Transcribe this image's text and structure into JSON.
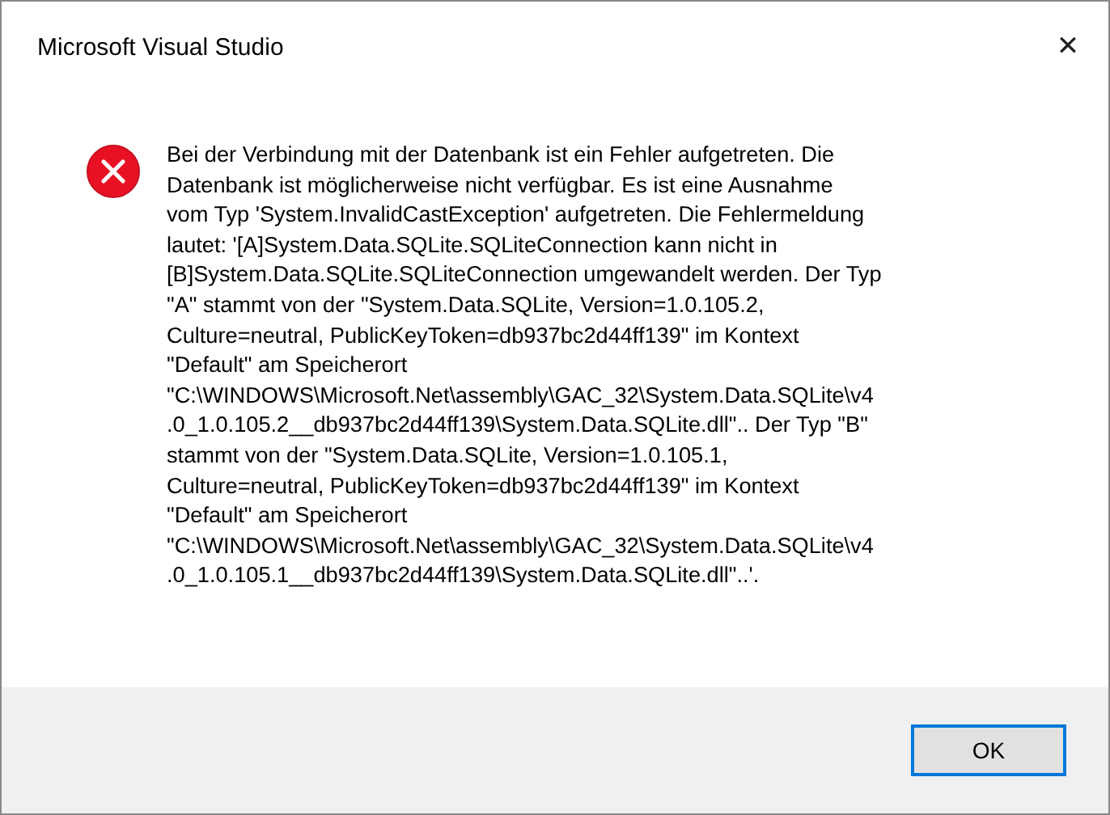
{
  "window": {
    "title": "Microsoft Visual Studio",
    "close": "✕"
  },
  "message": "Bei der Verbindung mit der Datenbank ist ein Fehler aufgetreten. Die\nDatenbank ist möglicherweise nicht verfügbar. Es ist eine Ausnahme\nvom Typ 'System.InvalidCastException' aufgetreten. Die Fehlermeldung\nlautet: '[A]System.Data.SQLite.SQLiteConnection kann nicht in\n[B]System.Data.SQLite.SQLiteConnection umgewandelt werden. Der Typ\n\"A\" stammt von der \"System.Data.SQLite, Version=1.0.105.2,\nCulture=neutral, PublicKeyToken=db937bc2d44ff139\" im Kontext\n\"Default\" am Speicherort\n\"C:\\WINDOWS\\Microsoft.Net\\assembly\\GAC_32\\System.Data.SQLite\\v4\n.0_1.0.105.2__db937bc2d44ff139\\System.Data.SQLite.dll\".. Der Typ \"B\"\nstammt von der \"System.Data.SQLite, Version=1.0.105.1,\nCulture=neutral, PublicKeyToken=db937bc2d44ff139\" im Kontext\n\"Default\" am Speicherort\n\"C:\\WINDOWS\\Microsoft.Net\\assembly\\GAC_32\\System.Data.SQLite\\v4\n.0_1.0.105.1__db937bc2d44ff139\\System.Data.SQLite.dll\"..'.",
  "buttons": [
    "OK"
  ]
}
